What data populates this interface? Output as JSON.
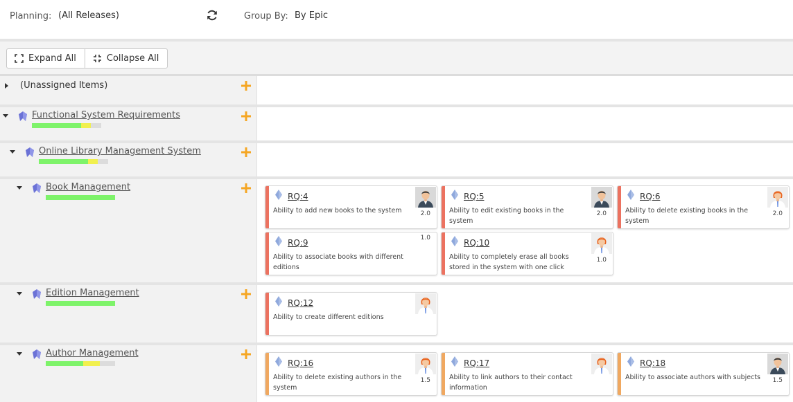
{
  "header": {
    "planning_label": "Planning:",
    "planning_value": "(All Releases)",
    "group_label": "Group By:",
    "group_value": "By Epic"
  },
  "toolbar": {
    "expand_label": "Expand All",
    "collapse_label": "Collapse All"
  },
  "tree": {
    "unassigned": "(Unassigned Items)",
    "functional": "Functional System Requirements",
    "online": "Online Library Management System",
    "book": "Book Management",
    "edition": "Edition Management",
    "author": "Author Management"
  },
  "progress": {
    "functional": [
      0.71,
      0.14
    ],
    "online": [
      0.71,
      0.14
    ],
    "book": [
      1.0,
      0.0
    ],
    "edition": [
      1.0,
      0.0
    ],
    "author": [
      0.54,
      0.24
    ]
  },
  "cards": {
    "rq4": {
      "id": "RQ:4",
      "desc": "Ability to add new books to the system",
      "estimate": "2.0"
    },
    "rq5": {
      "id": "RQ:5",
      "desc": "Ability to edit existing books in the system",
      "estimate": "2.0"
    },
    "rq6": {
      "id": "RQ:6",
      "desc": "Ability to delete existing books in the system",
      "estimate": "2.0"
    },
    "rq9": {
      "id": "RQ:9",
      "desc": "Ability to associate books with different editions",
      "estimate": "1.0"
    },
    "rq10": {
      "id": "RQ:10",
      "desc": "Ability to completely erase all books stored in the system with one click",
      "estimate": "1.0"
    },
    "rq12": {
      "id": "RQ:12",
      "desc": "Ability to create different editions",
      "estimate": ""
    },
    "rq16": {
      "id": "RQ:16",
      "desc": "Ability to delete existing authors in the system",
      "estimate": "1.5"
    },
    "rq17": {
      "id": "RQ:17",
      "desc": "Ability to link authors to their contact information",
      "estimate": ""
    },
    "rq18": {
      "id": "RQ:18",
      "desc": "Ability to associate authors with subjects",
      "estimate": "1.5"
    }
  },
  "colors": {
    "accent_orange": "#f5a623",
    "priority_high": "#ec7260",
    "priority_medium": "#f0a860",
    "epic_icon": "#6b72d6",
    "requirement_icon": "#8fa8dc",
    "progress_done": "#7ef36a",
    "progress_partial": "#f1f04e"
  },
  "icons": {
    "refresh": "refresh-icon",
    "expand": "expand-icon",
    "collapse": "collapse-icon",
    "add": "plus-icon",
    "epic": "epic-icon",
    "requirement": "requirement-icon",
    "owner": "avatar"
  }
}
